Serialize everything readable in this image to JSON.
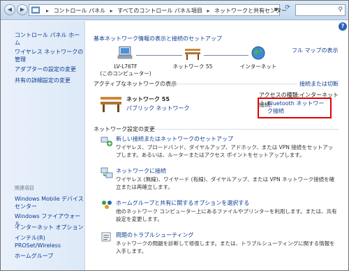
{
  "address_bar": {
    "crumbs": [
      "コントロール パネル",
      "すべてのコントロール パネル項目",
      "ネットワークと共有センター"
    ]
  },
  "sidebar": {
    "home": "コントロール パネル ホーム",
    "items": [
      "ワイヤレス ネットワークの管理",
      "アダプターの設定の変更",
      "共有の詳細設定の変更"
    ],
    "related_heading": "関連項目",
    "related": [
      "Windows Mobile デバイス センター",
      "Windows ファイアウォール",
      "インターネット オプション",
      "インテル(R) PROSet/Wireless",
      "ホームグループ"
    ]
  },
  "main": {
    "title": "基本ネットワーク情報の表示と接続のセットアップ",
    "full_map": "フル マップの表示",
    "nodes": {
      "computer_name": "LV-L76TF",
      "computer_sub": "(このコンピューター)",
      "network": "ネットワーク 55",
      "internet": "インターネット"
    },
    "active_heading": "アクティブなネットワークの表示",
    "connect_disconnect": "接続または切断",
    "active_network": {
      "name": "ネットワーク 55",
      "type": "パブリック ネットワーク",
      "access_label": "アクセスの種類:",
      "access_value": "インターネット",
      "connection_label": "接続:",
      "connection_value": "Bluetooth ネットワーク接続"
    },
    "settings_heading": "ネットワーク設定の変更",
    "tasks": [
      {
        "title": "新しい接続またはネットワークのセットアップ",
        "desc": "ワイヤレス、ブロードバンド、ダイヤルアップ、アドホック、または VPN 接続をセットアップします。あるいは、ルーターまたはアクセス ポイントをセットアップします。"
      },
      {
        "title": "ネットワークに接続",
        "desc": "ワイヤレス (無線)、ワイヤード (有線)、ダイヤルアップ、または VPN ネットワーク接続を確立または再確立します。"
      },
      {
        "title": "ホームグループと共有に関するオプションを選択する",
        "desc": "他のネットワーク コンピューター上にあるファイルやプリンターを利用します。または、共有設定を変更します。"
      },
      {
        "title": "問題のトラブルシューティング",
        "desc": "ネットワークの問題を診断して修復します。または、トラブルシューティングに関する情報を入手します。"
      }
    ]
  }
}
